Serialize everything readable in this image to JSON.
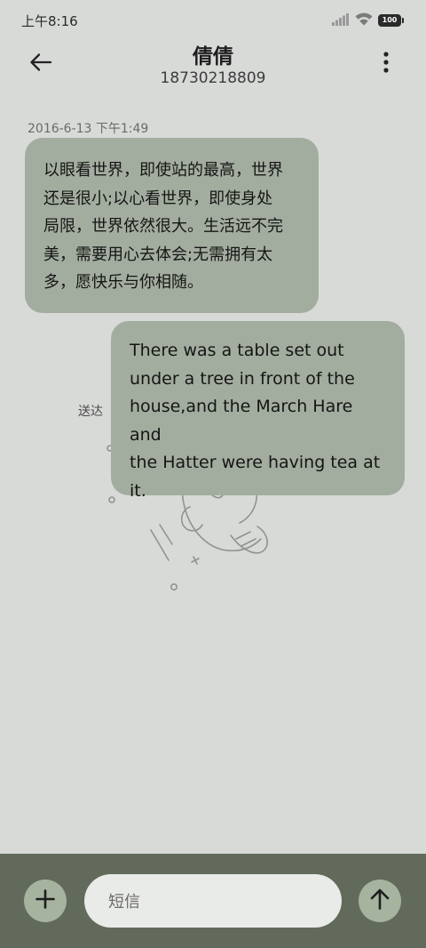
{
  "status_bar": {
    "time": "上午8:16",
    "battery": "100",
    "icons": [
      "signal-icon",
      "wifi-icon",
      "battery-icon"
    ]
  },
  "header": {
    "back_icon": "arrow-left-icon",
    "contact_name": "倩倩",
    "phone_number": "18730218809",
    "more_icon": "more-vertical-icon"
  },
  "conversation": {
    "timestamp": "2016-6-13 下午1:49",
    "messages": [
      {
        "direction": "incoming",
        "lines": [
          "以眼看世界，即使站的最高，世界",
          "还是很小;以心看世界，即使身处",
          "局限，世界依然很大。生活远不完",
          "美，需要用心去体会;无需拥有太",
          "多，愿快乐与你相随。"
        ]
      },
      {
        "direction": "outgoing",
        "lines": [
          "There was a table set out",
          "under a tree in front of the",
          "house,and the March Hare and",
          "the Hatter were having tea at",
          "it."
        ],
        "status": "送达"
      }
    ]
  },
  "composer": {
    "add_icon": "plus-icon",
    "placeholder": "短信",
    "send_icon": "arrow-up-icon"
  },
  "colors": {
    "background": "#d8dad8",
    "bubble": "#a3ad9f",
    "composer_bar": "#626a5c",
    "action_button": "#a6b39e",
    "input_field": "#e9ebe8"
  }
}
